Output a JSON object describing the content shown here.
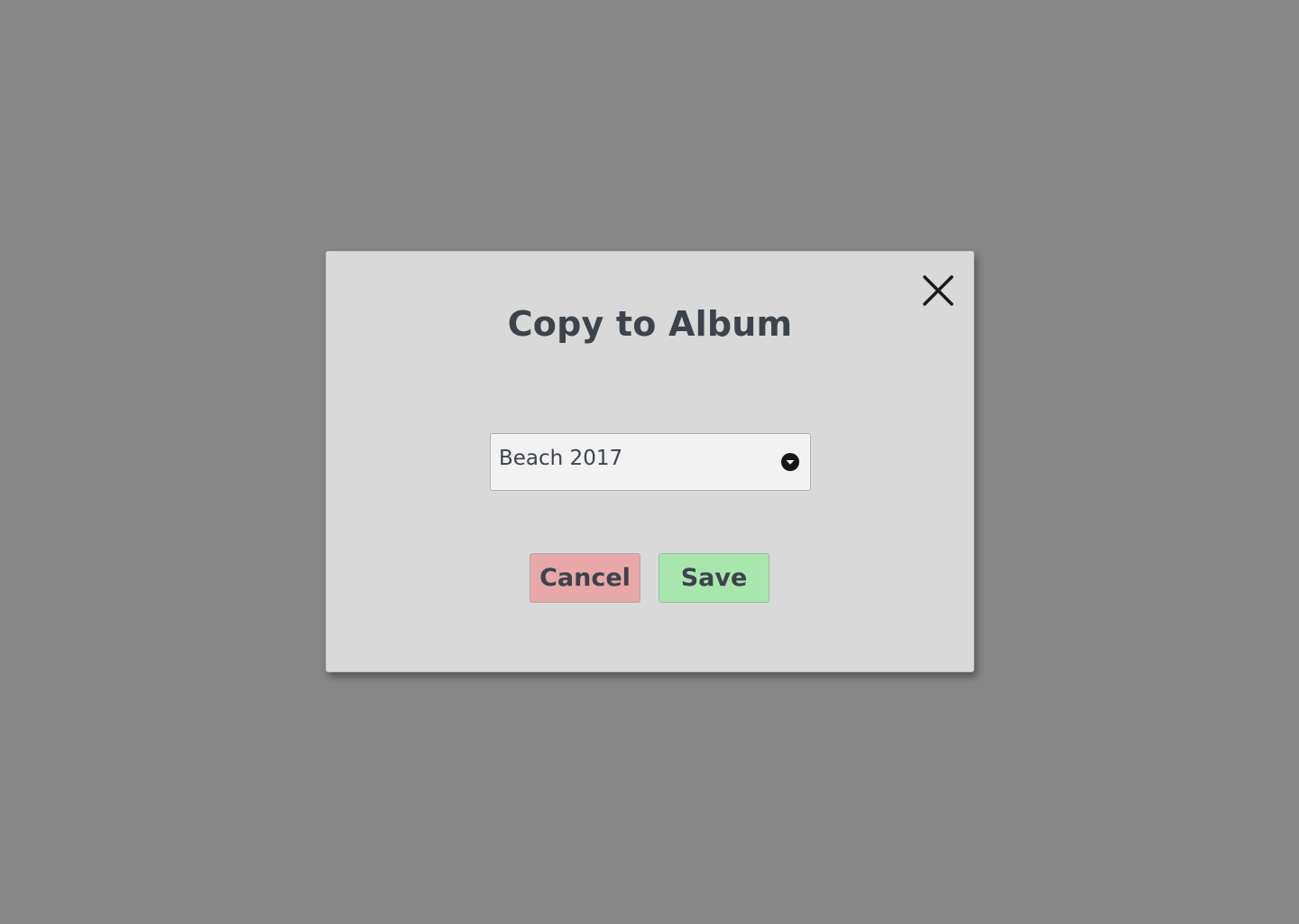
{
  "dialog": {
    "title": "Copy to Album",
    "close_icon": "close-icon",
    "album_select": {
      "selected_value": "Beach 2017",
      "icon": "chevron-down-circle-icon"
    },
    "cancel_label": "Cancel",
    "save_label": "Save"
  },
  "colors": {
    "backdrop": "#868686",
    "dialog_bg": "#d9d9d9",
    "text": "#3d434b",
    "cancel_bg": "#e8a8a8",
    "save_bg": "#a8e6ad",
    "select_bg": "#f2f2f2"
  }
}
